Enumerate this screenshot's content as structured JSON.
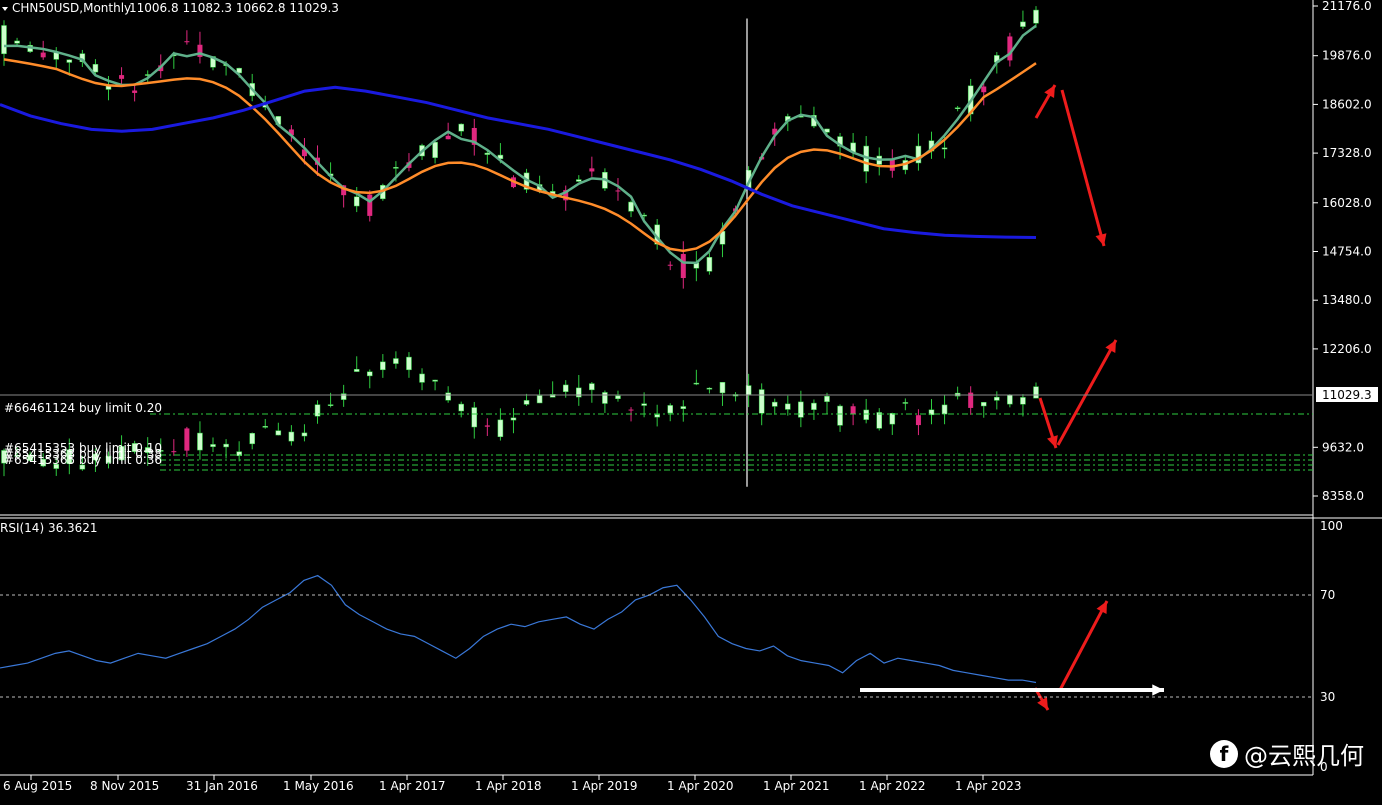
{
  "header": {
    "symbol_period": "CHN50USD,Monthly",
    "ohlc": "11006.8 11082.3 10662.8 11029.3"
  },
  "price_axis": {
    "ticks": [
      "21176.0",
      "19876.0",
      "18602.0",
      "17328.0",
      "16028.0",
      "14754.0",
      "13480.0",
      "12206.0",
      "9632.0",
      "8358.0"
    ],
    "current_price": "11029.3"
  },
  "orders": {
    "main_label": "#66461124 buy limit 0.20",
    "stacked_labels": [
      "#65415353 buy limit 0.10",
      "#65415363 buy limit 0.38",
      "#65415365 buy limit 0.36"
    ]
  },
  "rsi": {
    "label": "RSI(14) 36.3621",
    "levels": [
      "100",
      "70",
      "30",
      "0"
    ]
  },
  "time_axis": {
    "labels": [
      "6 Aug 2015",
      "8 Nov 2015",
      "31 Jan 2016",
      "1 May 2016",
      "1 Apr 2017",
      "1 Apr 2018",
      "1 Apr 2019",
      "1 Apr 2020",
      "1 Apr 2021",
      "1 Apr 2022",
      "1 Apr 2023"
    ]
  },
  "watermark": {
    "text": "@云熙几何"
  },
  "colors": {
    "background": "#000000",
    "bull_candle": "#ccffcc",
    "bull_wick": "#2ecc40",
    "bear_candle": "#e0287f",
    "ma_fast": "#5fb08a",
    "ma_mid": "#ff8c2a",
    "ma_slow": "#1a1adf",
    "rsi_line": "#3a78d8",
    "arrows": "#ee1c1c",
    "order_lines": "#2ecc40"
  },
  "chart_data": {
    "type": "candlestick",
    "upper_series": [
      {
        "name": "upper",
        "values": [
          20300,
          20200,
          20150,
          20050,
          19950,
          19800,
          19650,
          19500,
          19300,
          19100,
          19050,
          19200,
          19500,
          19800,
          20150,
          20000,
          19900,
          19700,
          19400,
          18900,
          18450,
          18200,
          17900,
          17500,
          17100,
          16650,
          16300,
          16050,
          16100,
          16400,
          16750,
          17050,
          17350,
          17600,
          17800,
          17900,
          17750,
          17450,
          17150,
          16800,
          16550,
          16300,
          16200,
          16350,
          16600,
          16750,
          16650,
          16400,
          16100,
          15700,
          15200,
          14700,
          14400,
          14300,
          14550,
          15200,
          15950,
          16650,
          17300,
          17850,
          18200,
          18350,
          18200,
          17900,
          17600,
          17350,
          17200,
          17100,
          17050,
          17100,
          17250,
          17500,
          17800,
          18200,
          18650,
          19100,
          19600,
          20050,
          20500,
          20900
        ]
      }
    ],
    "lower_series": [
      {
        "name": "lower",
        "values": [
          9450,
          9400,
          9380,
          9320,
          9280,
          9250,
          9280,
          9300,
          9340,
          9380,
          9450,
          9550,
          9650,
          9750,
          9800,
          9750,
          9700,
          9680,
          9700,
          9780,
          9850,
          9950,
          10100,
          10300,
          10550,
          10800,
          11100,
          11400,
          11650,
          11800,
          11850,
          11700,
          11450,
          11200,
          10950,
          10700,
          10500,
          10350,
          10300,
          10400,
          10600,
          10850,
          11050,
          11200,
          11250,
          11150,
          11000,
          10800,
          10650,
          10550,
          10500,
          10600,
          10800,
          11050,
          11250,
          11300,
          11200,
          11000,
          10850,
          10750,
          10650,
          10600,
          10550,
          10500,
          10450,
          10400,
          10380,
          10400,
          10450,
          10500,
          10550,
          10600,
          10650,
          10700,
          10750,
          10800,
          10850,
          10900,
          10950,
          11000
        ]
      }
    ],
    "rsi": [
      42,
      43,
      44,
      46,
      48,
      49,
      47,
      45,
      44,
      46,
      48,
      47,
      46,
      48,
      50,
      52,
      55,
      58,
      62,
      67,
      70,
      73,
      78,
      80,
      76,
      68,
      64,
      61,
      58,
      56,
      55,
      52,
      49,
      46,
      50,
      55,
      58,
      60,
      59,
      61,
      62,
      63,
      60,
      58,
      62,
      65,
      70,
      72,
      75,
      76,
      70,
      63,
      55,
      52,
      50,
      49,
      51,
      47,
      45,
      44,
      43,
      40,
      45,
      48,
      44,
      46,
      45,
      44,
      43,
      41,
      40,
      39,
      38,
      37,
      37,
      36
    ]
  }
}
